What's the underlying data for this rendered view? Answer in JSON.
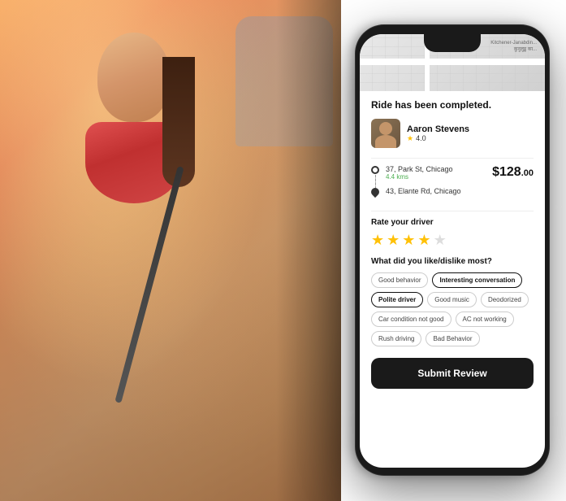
{
  "background": {
    "alt": "Woman smiling in car using phone"
  },
  "phone": {
    "map": {
      "label1": "Kitchener-Janabdin...",
      "label2": "कुनुलुड्ढ का..."
    },
    "ride_completed": "Ride has been completed.",
    "driver": {
      "name": "Aaron Stevens",
      "rating": "4.0",
      "avatar_alt": "Driver photo"
    },
    "route": {
      "pickup": "37, Park St, Chicago",
      "distance": "4.4 kms",
      "dropoff": "43, Elante Rd, Chicago",
      "fare": "$128",
      "fare_cents": ".00"
    },
    "rate_section": {
      "label": "Rate your driver",
      "stars_filled": 4,
      "stars_total": 5
    },
    "feedback": {
      "label": "What did you like/dislike most?",
      "tags": [
        {
          "label": "Good behavior",
          "active": false
        },
        {
          "label": "Interesting conversation",
          "active": true
        },
        {
          "label": "Polite driver",
          "active": true
        },
        {
          "label": "Good music",
          "active": false
        },
        {
          "label": "Deodorized",
          "active": false
        },
        {
          "label": "Car condition not good",
          "active": false
        },
        {
          "label": "AC not working",
          "active": false
        },
        {
          "label": "Rush driving",
          "active": false
        },
        {
          "label": "Bad Behavior",
          "active": false
        }
      ]
    },
    "submit_button": "Submit Review"
  }
}
